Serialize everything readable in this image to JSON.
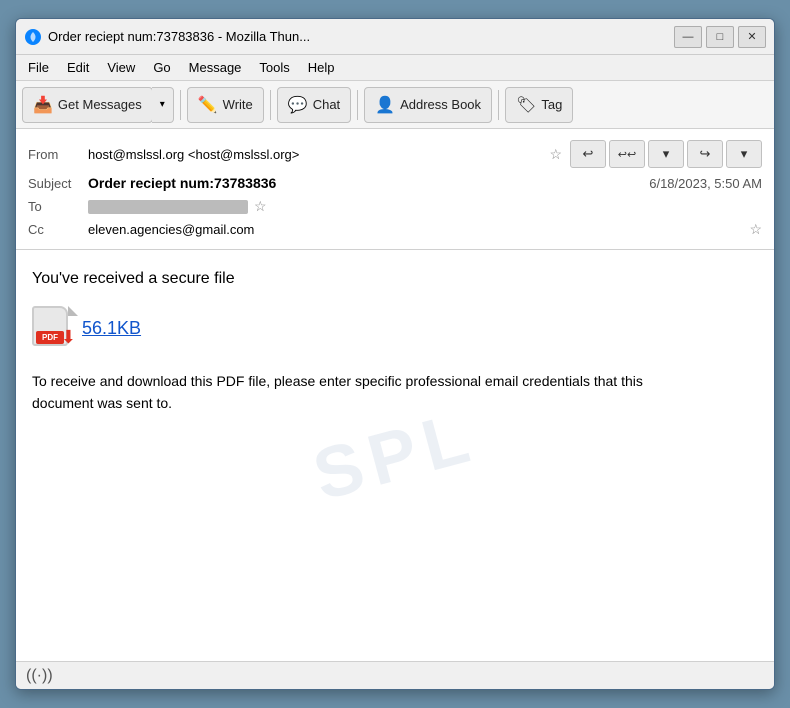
{
  "window": {
    "title": "Order reciept num:73783836 - Mozilla Thun...",
    "icon_label": "thunderbird-icon"
  },
  "title_controls": {
    "minimize": "—",
    "maximize": "□",
    "close": "✕"
  },
  "menu": {
    "items": [
      "File",
      "Edit",
      "View",
      "Go",
      "Message",
      "Tools",
      "Help"
    ]
  },
  "toolbar": {
    "get_messages": "Get Messages",
    "write": "Write",
    "chat": "Chat",
    "address_book": "Address Book",
    "tag": "Tag"
  },
  "email": {
    "from_label": "From",
    "from_value": "host@mslssl.org <host@mslssl.org>",
    "subject_label": "Subject",
    "subject_value": "Order reciept num:73783836",
    "date": "6/18/2023, 5:50 AM",
    "to_label": "To",
    "to_redacted": true,
    "cc_label": "Cc",
    "cc_value": "eleven.agencies@gmail.com"
  },
  "content": {
    "secure_file_text": "You've received a secure file",
    "attachment_size": "56.1KB",
    "download_text": "To receive and download this PDF file, please enter specific professional email credentials that this document was sent to."
  },
  "watermark": {
    "text": "SPL"
  },
  "status_bar": {
    "connection_label": "connection-status-icon"
  }
}
